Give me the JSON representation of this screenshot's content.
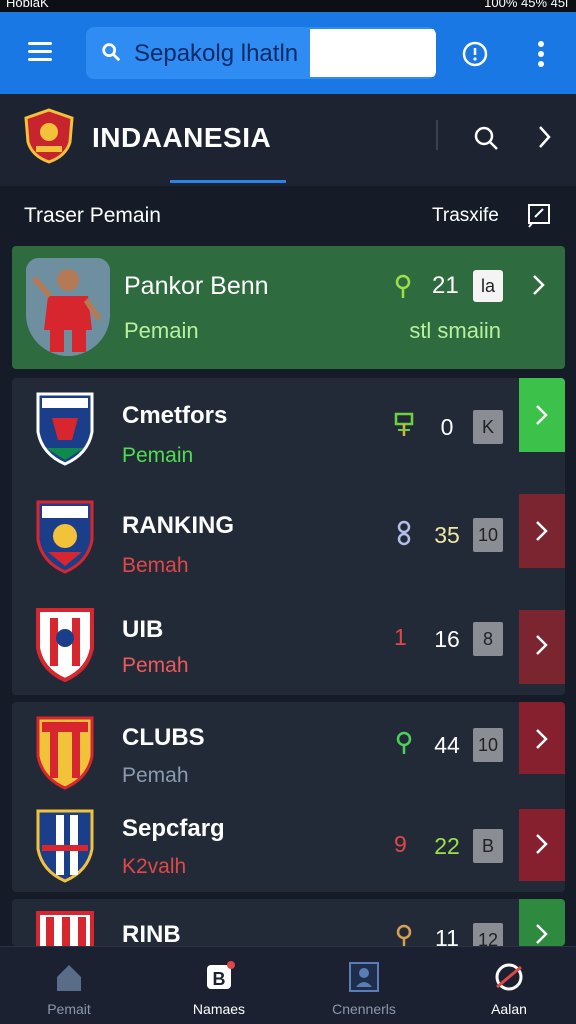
{
  "status_bar": {
    "left_text": "HoblaK",
    "right_text": "100% 45%  45l"
  },
  "search": {
    "value": "Sepakolg lhatln"
  },
  "header": {
    "team_name": "INDAANESIA"
  },
  "section": {
    "title": "Traser Pemain",
    "action_label": "Trasxife"
  },
  "featured_player": {
    "name": "Pankor Benn",
    "subtitle": "Pemain",
    "stat": "21",
    "badge": "la",
    "right_subtitle": "stl smaiin"
  },
  "rows": [
    {
      "title": "Cmetfors",
      "subtitle": "Pemain",
      "subtitle_color": "#4ede4e",
      "stat": "0",
      "badge": "K",
      "action_color": "#3cc24a",
      "icon_color": "#6ed23c"
    },
    {
      "title": "RANKING",
      "subtitle": "Bemah",
      "subtitle_color": "#e04848",
      "stat": "35",
      "badge": "10",
      "action_color": "#7a2530",
      "icon_color": "#b4bde8"
    },
    {
      "title": "UIB",
      "subtitle": "Pemah",
      "subtitle_color": "#ec5a5a",
      "stat_prefix": "1",
      "stat": "16",
      "badge": "8",
      "action_color": "#7a2530",
      "icon_color": "#e04848"
    },
    {
      "title": "CLUBS",
      "subtitle": "Pemah",
      "subtitle_color": "#8a9bb0",
      "stat": "44",
      "badge": "10",
      "action_color": "#86202e",
      "icon_color": "#4bd05a"
    },
    {
      "title": "Sepcfarg",
      "subtitle": "K2valh",
      "subtitle_color": "#e04848",
      "stat_prefix": "9",
      "stat": "22",
      "badge": "B",
      "action_color": "#86202e",
      "icon_color": "#e04848"
    },
    {
      "title": "RINB",
      "subtitle": "",
      "subtitle_color": "#8a9bb0",
      "stat": "11",
      "badge": "12",
      "action_color": "#2e8a3e",
      "icon_color": "#d8a050"
    }
  ],
  "nav": [
    {
      "label": "Pemait",
      "icon": "home-icon"
    },
    {
      "label": "Namaes",
      "icon": "notification-icon"
    },
    {
      "label": "Cnennerls",
      "icon": "team-icon"
    },
    {
      "label": "Aalan",
      "icon": "logo-icon"
    }
  ],
  "colors": {
    "app_bar": "#1a78e4",
    "background": "#151b27",
    "card_green": "#2e6b3e",
    "row_bg": "#222a38"
  }
}
